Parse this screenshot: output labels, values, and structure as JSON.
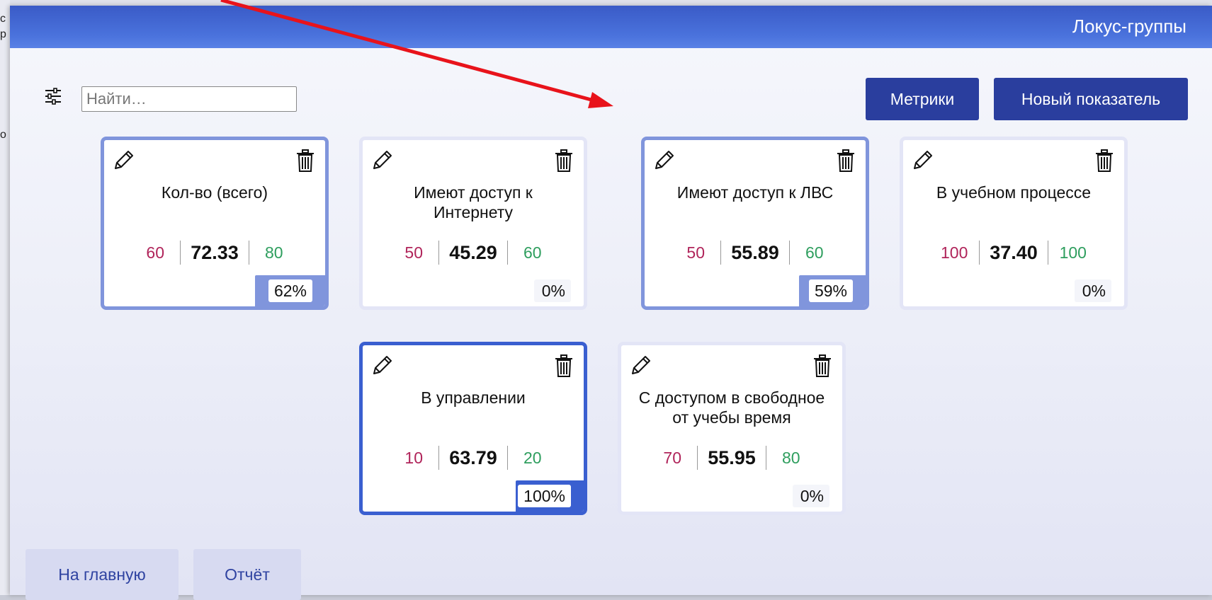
{
  "background_fragments": [
    "с",
    "р",
    "о"
  ],
  "dialog": {
    "title": "Локус-группы",
    "search_placeholder": "Найти…",
    "buttons": {
      "metrics": "Метрики",
      "new_indicator": "Новый показатель"
    },
    "bottom_buttons": {
      "home": "На главную",
      "report": "Отчёт"
    }
  },
  "cards": [
    {
      "name": "Кол-во (всего)",
      "min": "60",
      "current": "72.33",
      "max": "80",
      "percent": "62%",
      "progress": 0.62,
      "state": "selected"
    },
    {
      "name": "Имеют доступ к Интернету",
      "min": "50",
      "current": "45.29",
      "max": "60",
      "percent": "0%",
      "progress": 0,
      "state": "normal"
    },
    {
      "name": "Имеют доступ к ЛВС",
      "min": "50",
      "current": "55.89",
      "max": "60",
      "percent": "59%",
      "progress": 0.59,
      "state": "selected"
    },
    {
      "name": "В учебном процессе",
      "min": "100",
      "current": "37.40",
      "max": "100",
      "percent": "0%",
      "progress": 0,
      "state": "normal"
    },
    {
      "name": "В управлении",
      "min": "10",
      "current": "63.79",
      "max": "20",
      "percent": "100%",
      "progress": 1.0,
      "state": "active"
    },
    {
      "name": "С доступом в свободное от учебы время",
      "min": "70",
      "current": "55.95",
      "max": "80",
      "percent": "0%",
      "progress": 0,
      "state": "normal"
    }
  ],
  "colors": {
    "titlebar": "#3a5bc7",
    "primary_button": "#2a3e9e",
    "selected_border": "#8095dc",
    "active_border": "#3a5fd0",
    "min_value": "#b0245a",
    "max_value": "#2e9e5e",
    "annotation_arrow": "#e8131b"
  },
  "icons": [
    "filter-sliders-icon",
    "pencil-icon",
    "trash-icon"
  ]
}
